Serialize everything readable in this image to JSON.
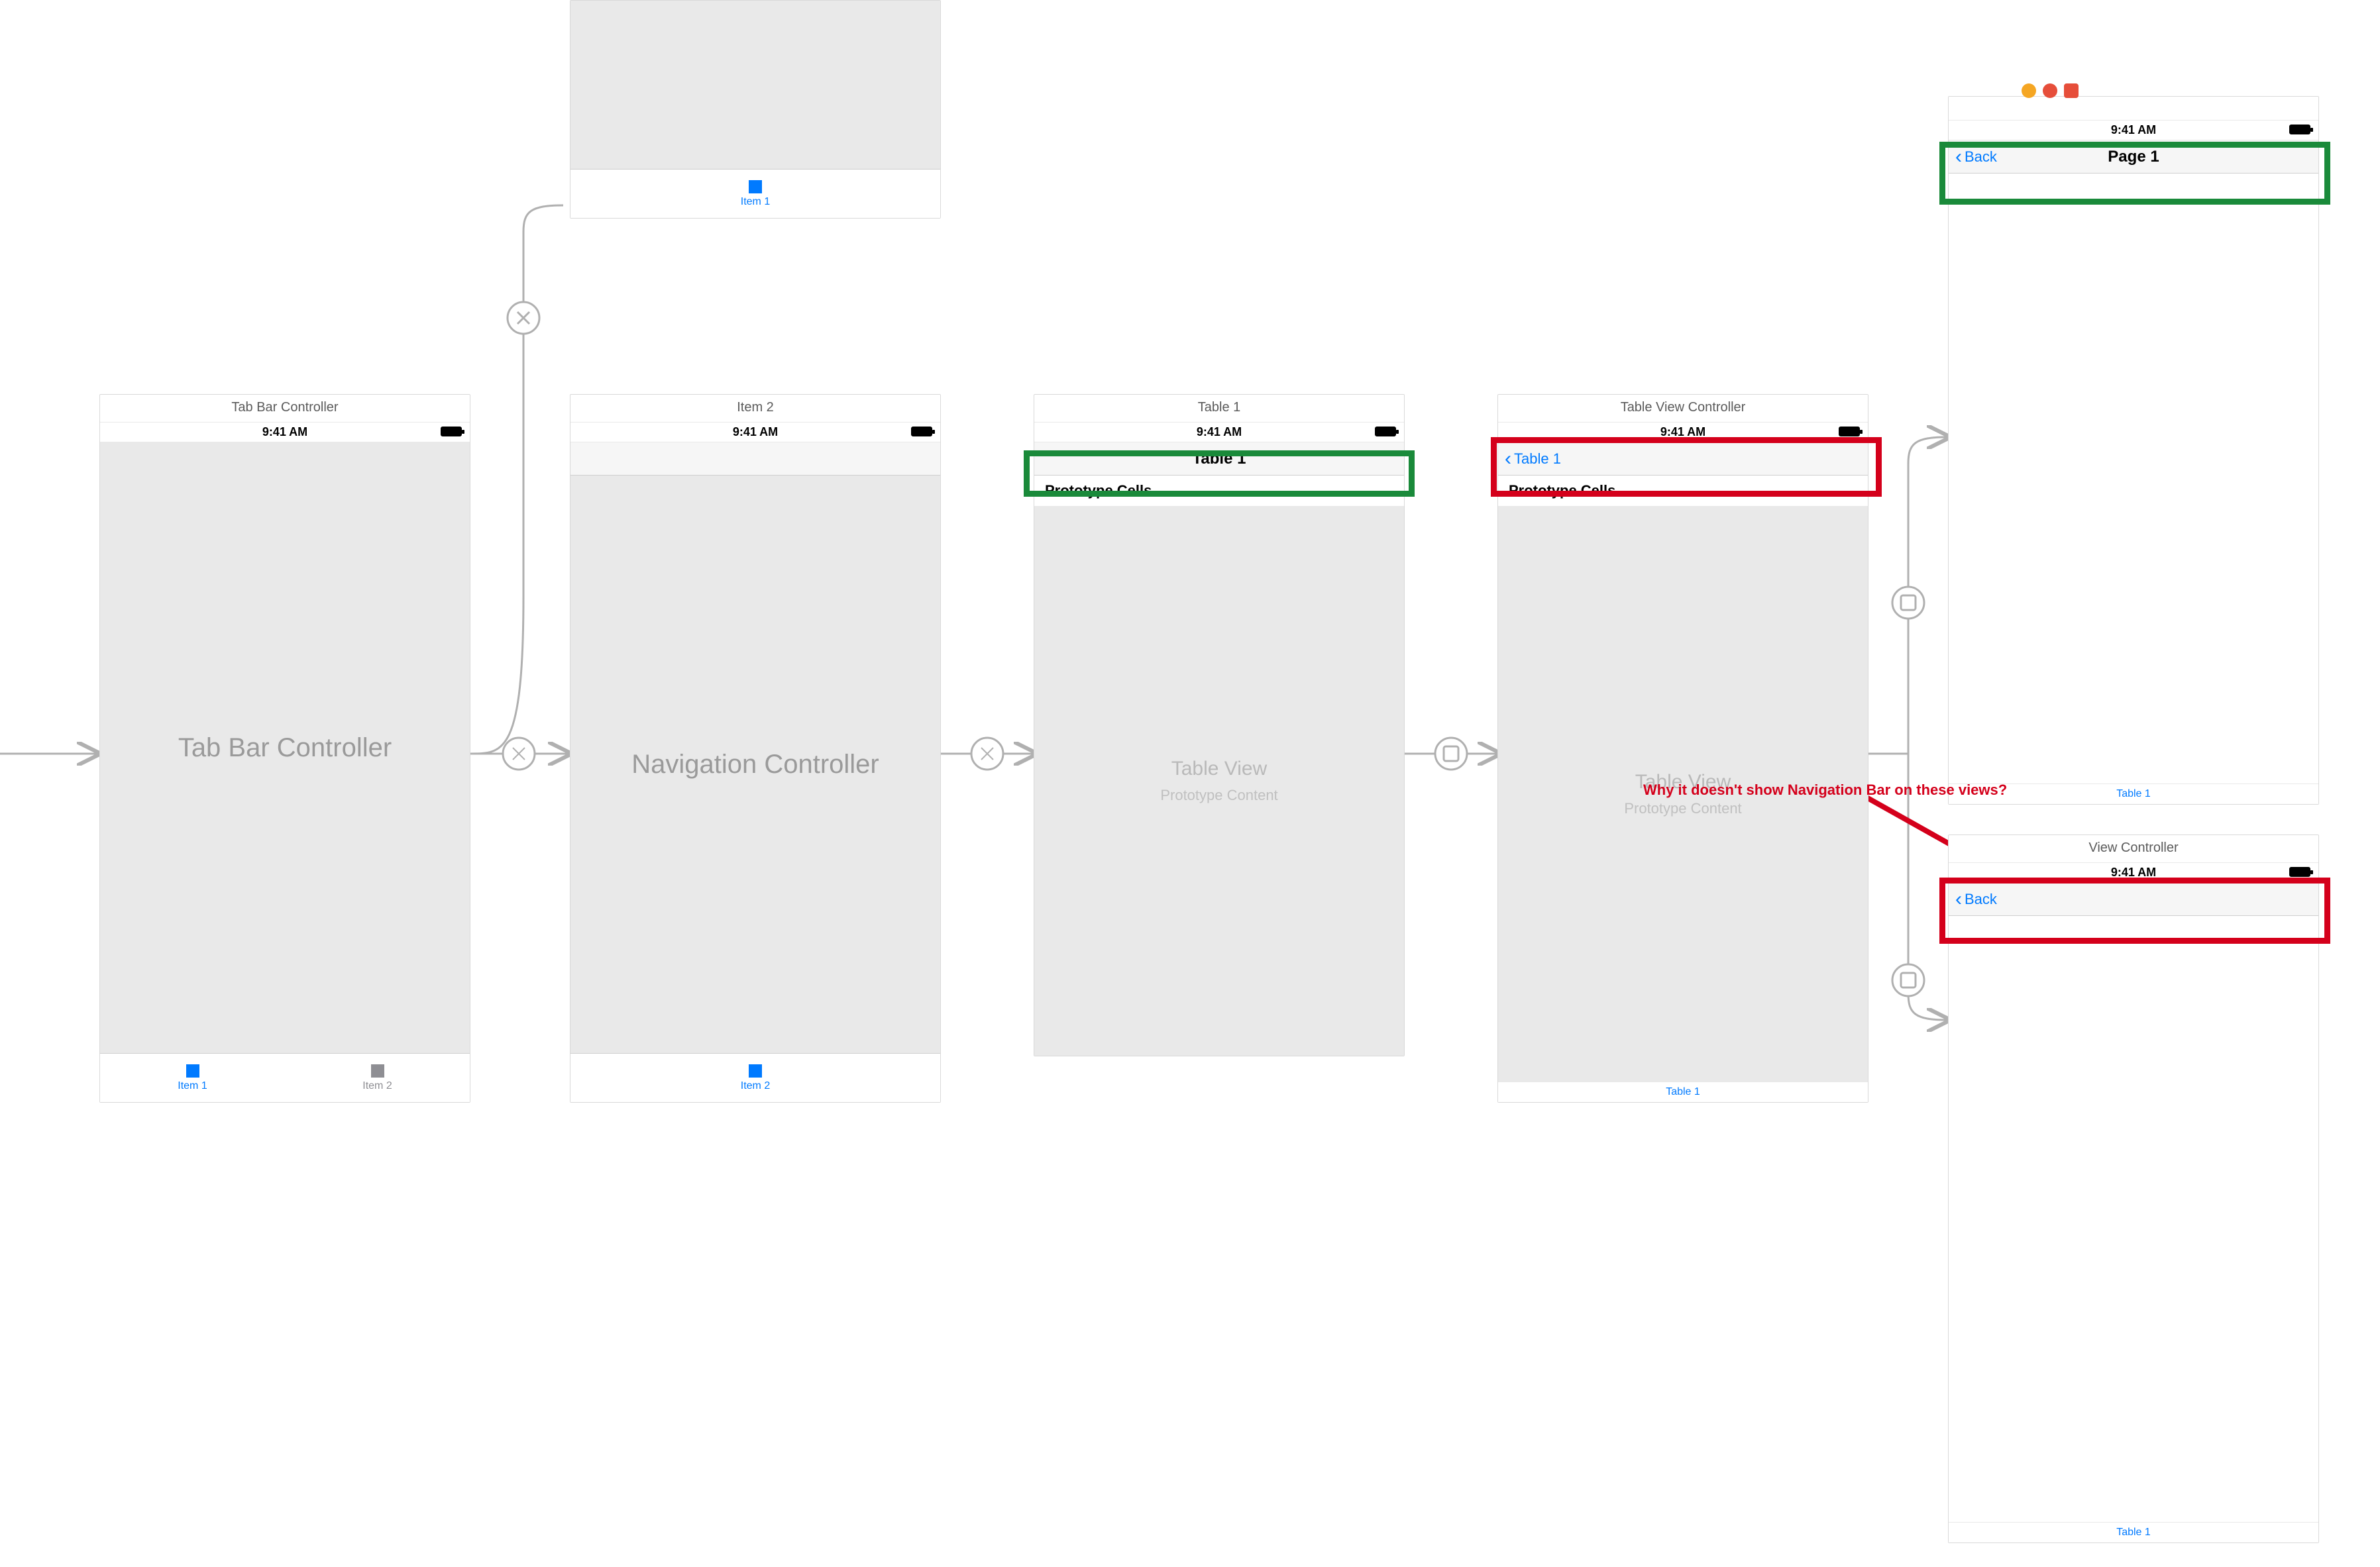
{
  "time": "9:41 AM",
  "tabs": {
    "item1": "Item 1",
    "item2": "Item 2"
  },
  "link": {
    "table1": "Table 1"
  },
  "tableview_big": "Table View",
  "tableview_sub": "Prototype Content",
  "proto_cells": "Prototype Cells",
  "scene1": {
    "title": "Tab Bar Controller",
    "label": "Tab Bar Controller"
  },
  "scene_top": {
    "tab_label": "Item 1"
  },
  "scene2": {
    "title": "Item 2",
    "label": "Navigation Controller",
    "tab_label": "Item 2"
  },
  "scene3": {
    "title": "Table 1",
    "nav_title": "Table 1"
  },
  "scene4": {
    "title": "Table View Controller",
    "back": "Table 1"
  },
  "scene5": {
    "nav_title": "Page 1",
    "back": "Back"
  },
  "scene6": {
    "title": "View Controller",
    "back": "Back"
  },
  "annotation": "Why it doesn't show Navigation Bar on these views?"
}
